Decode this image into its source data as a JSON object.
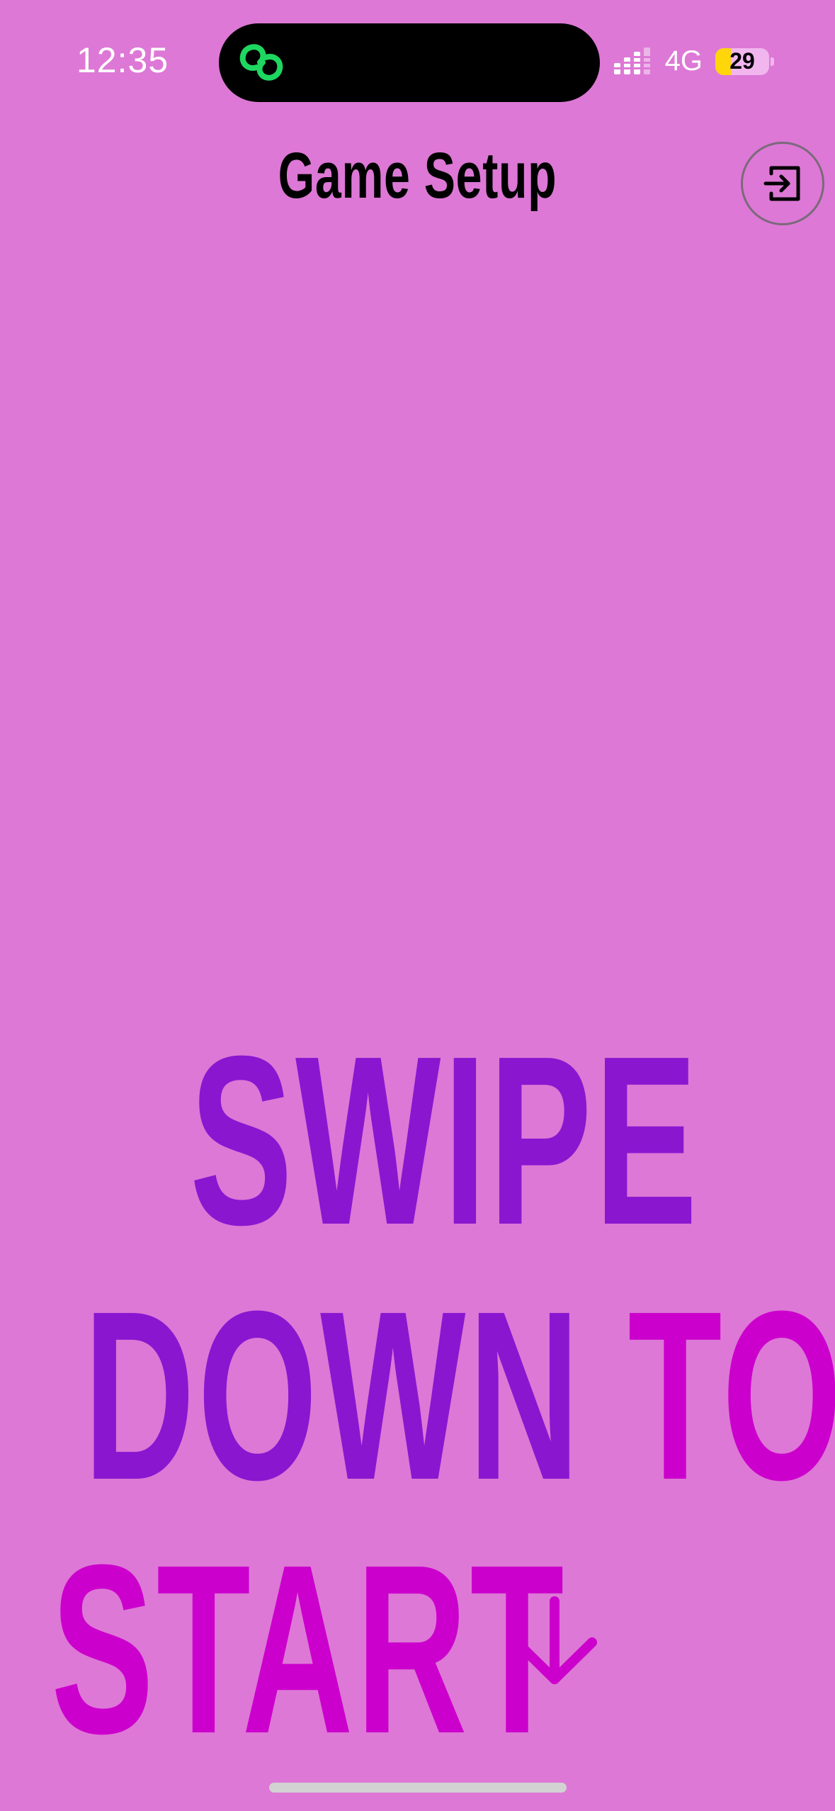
{
  "status_bar": {
    "time": "12:35",
    "network": "4G",
    "battery_level": "29",
    "island_icon": "link-icon"
  },
  "header": {
    "title": "Game Setup",
    "exit_icon": "exit-icon"
  },
  "prompt": {
    "line1": "SWIPE",
    "line2_word1": "DOWN",
    "line2_word2": "TO",
    "line3": "START",
    "arrow_icon": "arrow-down-icon"
  },
  "colors": {
    "background": "#DD78D6",
    "purple": "#8A16D0",
    "magenta": "#CC00CC",
    "link_green": "#1ED760"
  }
}
